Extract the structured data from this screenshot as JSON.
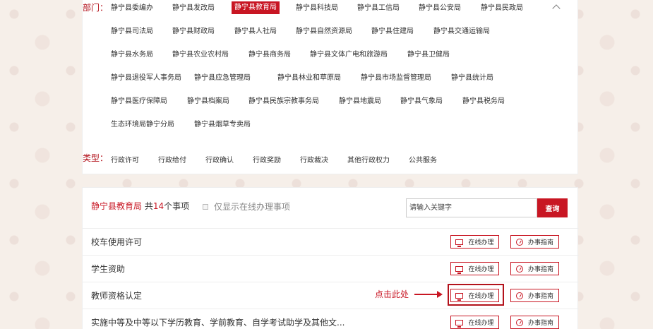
{
  "filters": {
    "department_label": "部门：",
    "type_label": "类型：",
    "departments": [
      [
        "静宁县委编办",
        "静宁县发改局",
        "静宁县教育局",
        "静宁县科技局",
        "静宁县工信局",
        "静宁县公安局",
        "静宁县民政局"
      ],
      [
        "静宁县司法局",
        "静宁县财政局",
        "静宁县人社局",
        "静宁县自然资源局",
        "静宁县住建局",
        "静宁县交通运输局"
      ],
      [
        "静宁县水务局",
        "静宁县农业农村局",
        "静宁县商务局",
        "静宁县文体广电和旅游局",
        "静宁县卫健局"
      ],
      [
        "静宁县退役军人事务局",
        "静宁县应急管理局",
        "静宁县林业和草原局",
        "静宁县市场监督管理局",
        "静宁县统计局"
      ],
      [
        "静宁县医疗保障局",
        "静宁县档案局",
        "静宁县民族宗教事务局",
        "静宁县地震局",
        "静宁县气象局",
        "静宁县税务局"
      ],
      [
        "生态环境局静宁分局",
        "静宁县烟草专卖局"
      ]
    ],
    "active_department": "静宁县教育局",
    "types": [
      "行政许可",
      "行政给付",
      "行政确认",
      "行政奖励",
      "行政裁决",
      "其他行政权力",
      "公共服务"
    ]
  },
  "list": {
    "dept_name": "静宁县教育局",
    "count_prefix": " 共",
    "count": "14",
    "count_suffix": "个事项",
    "online_only_label": "仅显示在线办理事项",
    "search_placeholder": "请输入关键字",
    "search_button": "查询",
    "online_button": "在线办理",
    "guide_button": "办事指南",
    "annotation": "点击此处",
    "items": [
      "校车使用许可",
      "学生资助",
      "教师资格认定",
      "实施中等及中等以下学历教育、学前教育、自学考试助学及其他文..."
    ]
  },
  "colors": {
    "accent": "#c81623",
    "label": "#b3121b"
  }
}
